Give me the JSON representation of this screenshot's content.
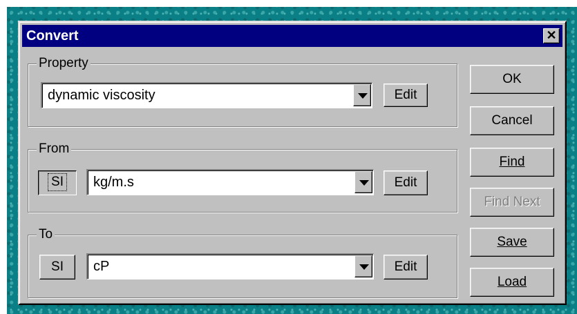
{
  "window": {
    "title": "Convert",
    "close_glyph": "✕"
  },
  "property": {
    "group_label": "Property",
    "value": "dynamic viscosity",
    "edit_label": "Edit"
  },
  "from": {
    "group_label": "From",
    "si_label": "SI",
    "value": "kg/m.s",
    "edit_label": "Edit"
  },
  "to": {
    "group_label": "To",
    "si_label": "SI",
    "value": "cP",
    "edit_label": "Edit"
  },
  "actions": {
    "ok": "OK",
    "cancel": "Cancel",
    "find": "Find",
    "find_next": "Find Next",
    "save": "Save",
    "load": "Load"
  },
  "colors": {
    "title_bar": "#000080",
    "dialog_face": "#c0c0c0",
    "desktop": "#0b7f86"
  }
}
